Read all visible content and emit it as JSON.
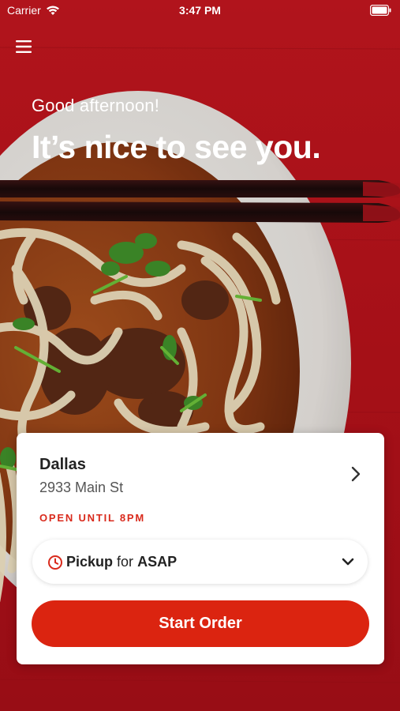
{
  "status_bar": {
    "carrier": "Carrier",
    "time": "3:47 PM",
    "wifi_icon": "wifi-icon",
    "battery_icon": "battery-icon"
  },
  "header": {
    "menu_icon": "hamburger-menu-icon",
    "greeting": "Good afternoon!",
    "headline": "It’s nice to see you."
  },
  "location_card": {
    "city": "Dallas",
    "address": "2933 Main St",
    "hours": "OPEN UNTIL 8PM",
    "chevron_icon": "chevron-right-icon",
    "order_mode": {
      "icon": "clock-icon",
      "method": "Pickup",
      "connector": "for",
      "time": "ASAP",
      "dropdown_icon": "chevron-down-icon"
    },
    "start_button_label": "Start Order"
  },
  "colors": {
    "background_red": "#b8141c",
    "accent_red": "#db2410",
    "hours_red": "#d92a1c"
  },
  "background_image": "food-photo-noodle-bowl-with-chopsticks"
}
